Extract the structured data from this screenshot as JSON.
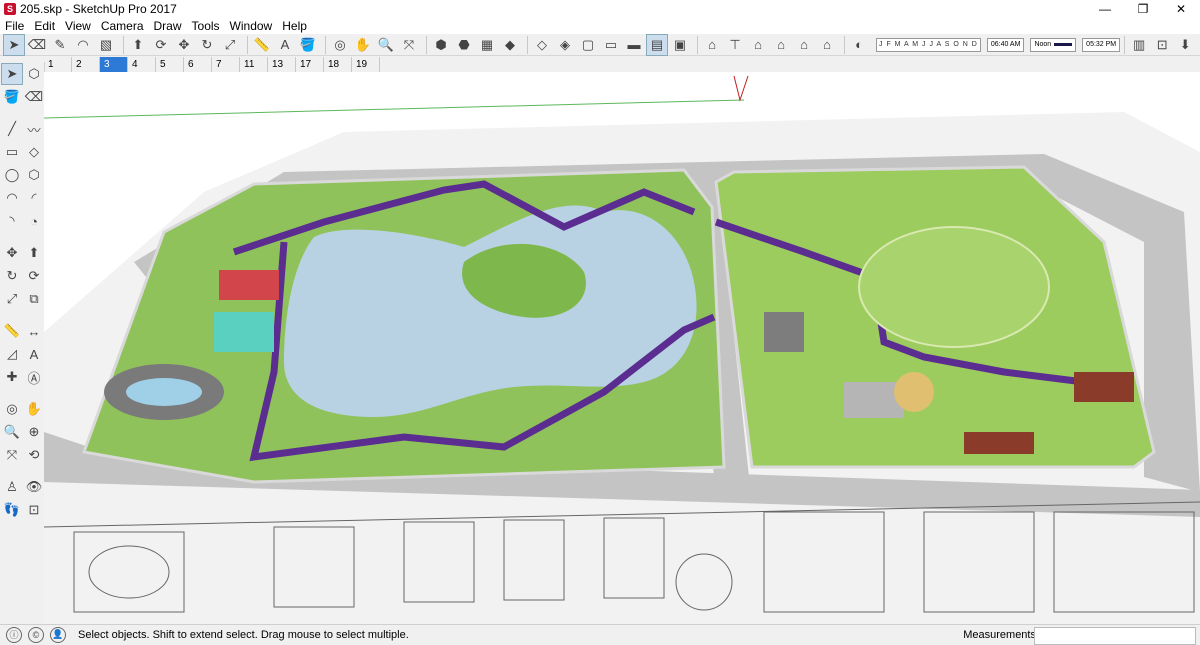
{
  "window": {
    "title": "205.skp - SketchUp Pro 2017",
    "app_icon": "S",
    "controls": {
      "minimize": "—",
      "maximize": "❐",
      "close": "✕"
    }
  },
  "menu": [
    "File",
    "Edit",
    "View",
    "Camera",
    "Draw",
    "Tools",
    "Window",
    "Help"
  ],
  "toolbar": {
    "months": "J F M A M J J A S O N D",
    "time_start": "06:40 AM",
    "time_mid": "Noon",
    "time_end": "05:32 PM"
  },
  "scenes": {
    "tabs": [
      "1",
      "2",
      "3",
      "4",
      "5",
      "6",
      "7",
      "11",
      "13",
      "17",
      "18",
      "19"
    ],
    "active": "3"
  },
  "status": {
    "text": "Select objects. Shift to extend select. Drag mouse to select multiple.",
    "measurements_label": "Measurements",
    "measurements_value": ""
  },
  "colors": {
    "park": "#8bc34a",
    "lake": "#b7d3e6",
    "path": "#5b2d91",
    "road": "#bdbdbd",
    "accent": "#2d7ad6"
  }
}
